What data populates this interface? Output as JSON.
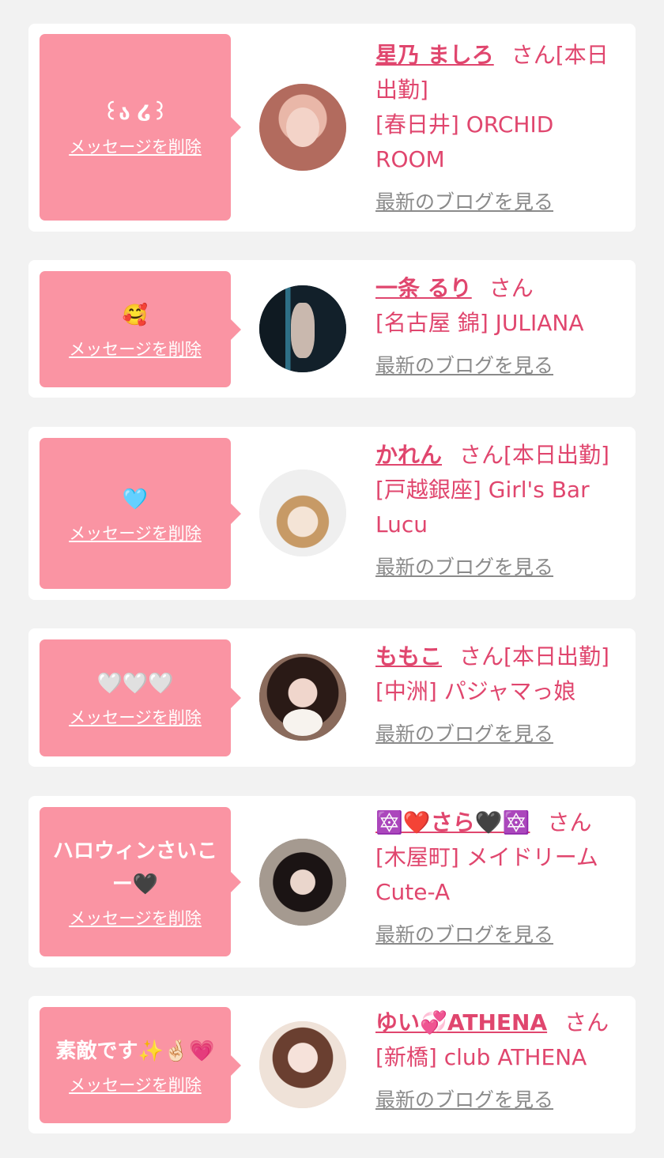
{
  "delete_label": "メッセージを削除",
  "blog_label": "最新のブログを見る",
  "honorific": "さん",
  "colors": {
    "bubble": "#fa94a3",
    "accent": "#e0466e",
    "link_gray": "#8a8a8a",
    "background": "#f2f2f2"
  },
  "cards": [
    {
      "message": "꒰ა ໒꒱",
      "name": "星乃 ましろ",
      "status": "[本日出勤]",
      "shop": "[春日井] ORCHID ROOM",
      "avatar": "avatar-photo"
    },
    {
      "message": "🥰",
      "name": "一条 るり",
      "status": "",
      "shop": "[名古屋 錦] JULIANA",
      "avatar": "avatar-photo"
    },
    {
      "message": "🩵",
      "name": "かれん",
      "status": "[本日出勤]",
      "shop": "[戸越銀座] Girl's Bar Lucu",
      "avatar": "avatar-photo"
    },
    {
      "message": "🤍🤍🤍",
      "name": "ももこ",
      "status": "[本日出勤]",
      "shop": "[中洲] パジャマっ娘",
      "avatar": "avatar-photo"
    },
    {
      "message": "ハロウィンさいこー🖤",
      "name": "🔯❤️さら🖤🔯",
      "status": "",
      "shop": "[木屋町] メイドリーム Cute-A",
      "avatar": "avatar-photo"
    },
    {
      "message": "素敵です✨🤞🏻💗",
      "name": "ゆい💞ATHENA",
      "status": "",
      "shop": "[新橋] club ATHENA",
      "avatar": "avatar-photo"
    }
  ]
}
